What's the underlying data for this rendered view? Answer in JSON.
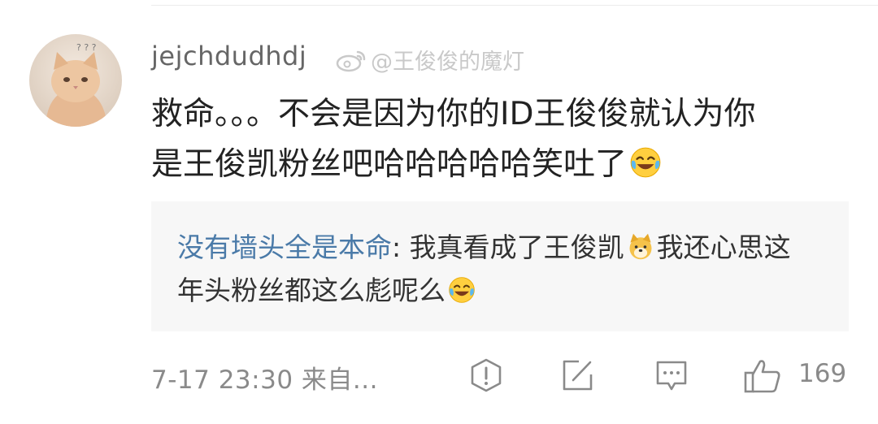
{
  "comment": {
    "username": "jejchdudhdj",
    "watermark": "@王俊俊的魔灯",
    "text": "救命。。。不会是因为你的ID王俊俊就认为你是王俊凯粉丝吧哈哈哈哈哈笑吐了",
    "emoji": "laugh-cry-emoji"
  },
  "reply": {
    "author": "没有墙头全是本命",
    "separator": ": ",
    "text_part1": "我真看成了王俊凯",
    "text_part2": "我还心思这年头粉丝都这么彪呢么",
    "emoji1": "dog-emoji",
    "emoji2": "laugh-cry-emoji"
  },
  "footer": {
    "timestamp": "7-17 23:30  来自...",
    "icons": [
      "report-icon",
      "share-icon",
      "comment-icon",
      "like-icon"
    ],
    "like_count": "169"
  },
  "colors": {
    "username": "#666666",
    "reply_author": "#4a7aa8",
    "reply_background": "#f7f7f7",
    "meta_text": "#8a8a8a"
  }
}
